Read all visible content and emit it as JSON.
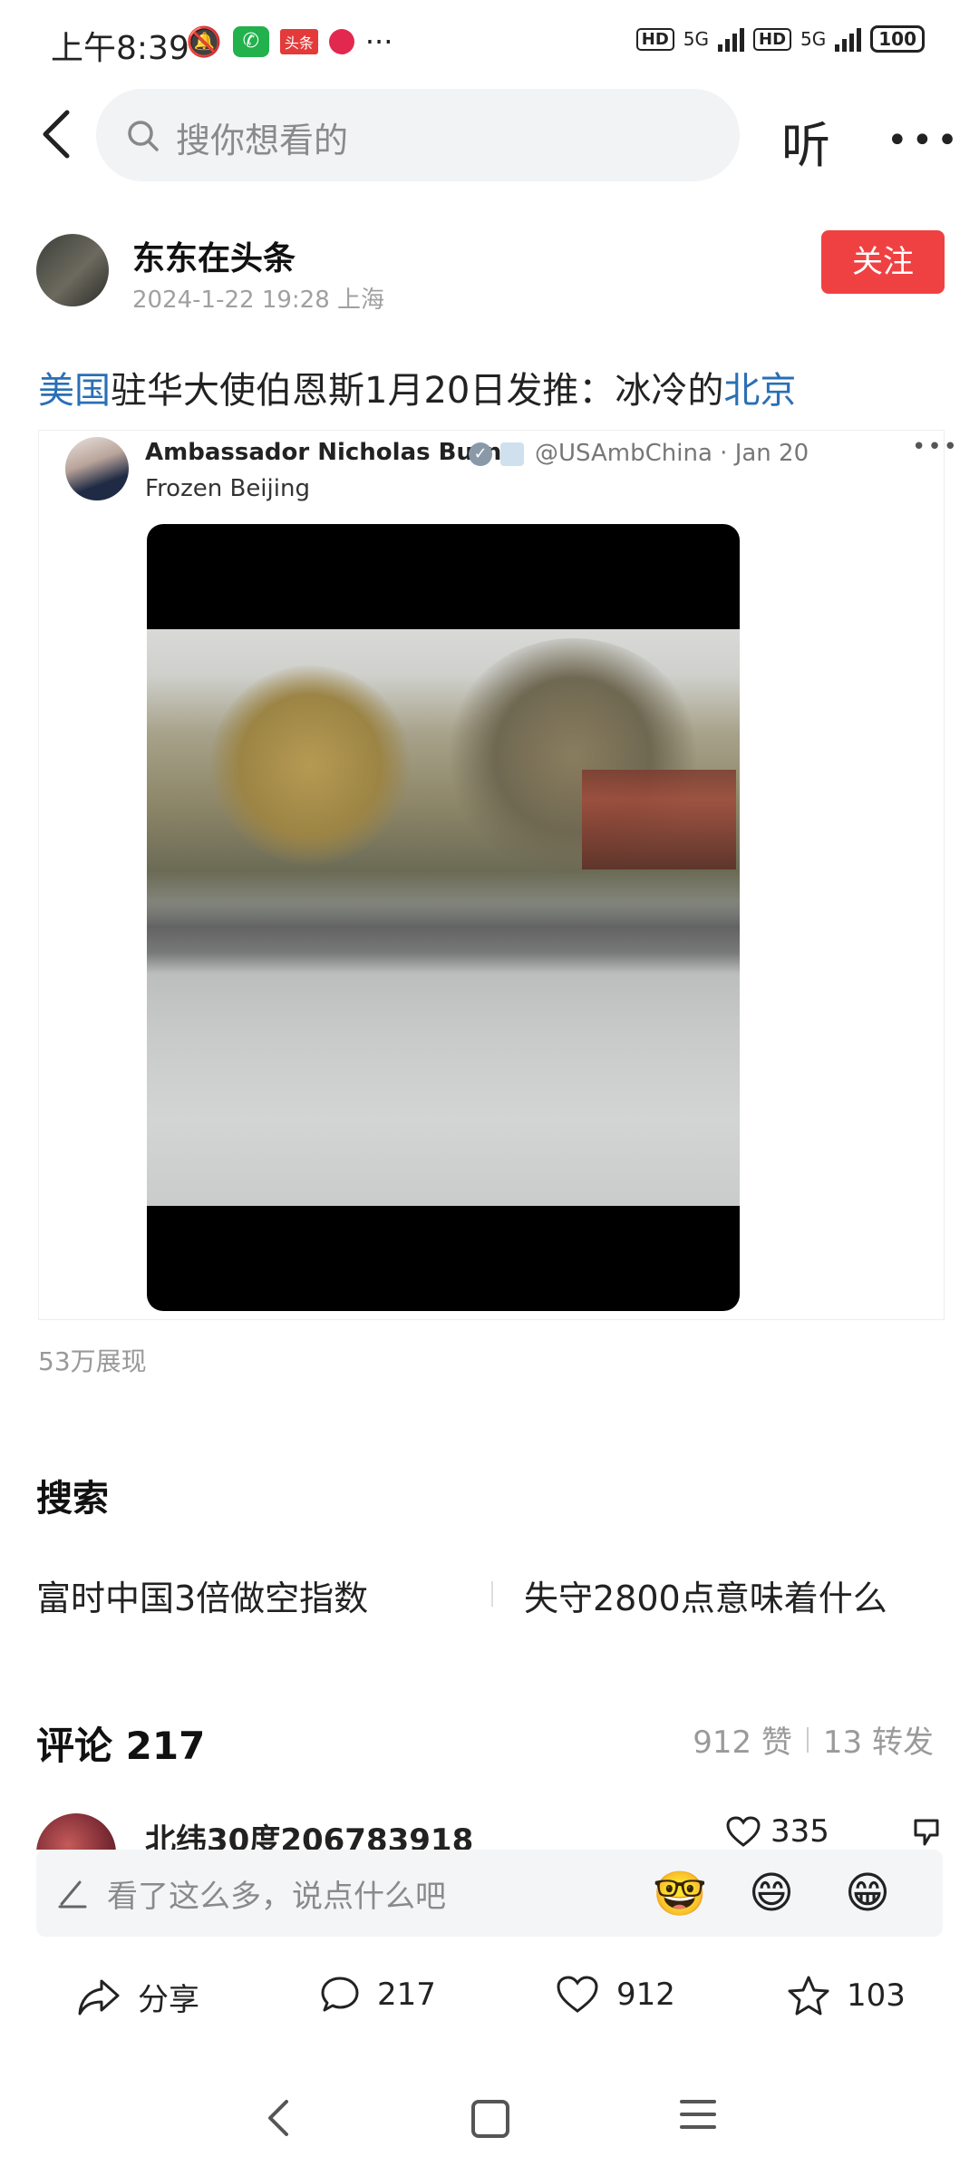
{
  "status_bar": {
    "time": "上午8:39",
    "toutiao_badge": "头条",
    "network_1": "5G",
    "network_2": "5G",
    "hd_1": "HD",
    "hd_2": "HD",
    "battery": "100"
  },
  "header": {
    "search_placeholder": "搜你想看的",
    "listen_label": "听"
  },
  "author": {
    "name": "东东在头条",
    "meta": "2024-1-22 19:28 上海",
    "follow_label": "关注"
  },
  "post": {
    "title_kw1": "美国",
    "title_mid": "驻华大使伯恩斯1月20日发推：冰冷的",
    "title_kw2": "北京",
    "views": "53万展现"
  },
  "tweet": {
    "author": "Ambassador Nicholas Burns",
    "handle": "@USAmbChina · Jan 20",
    "text": "Frozen Beijing"
  },
  "search_section": {
    "heading": "搜索",
    "suggestions": [
      "富时中国3倍做空指数",
      "失守2800点意味着什么"
    ]
  },
  "comments": {
    "title": "评论 217",
    "likes_stat": "912 赞",
    "shares_stat": "13 转发",
    "first": {
      "name": "北纬30度206783918",
      "likes": "335"
    },
    "input_placeholder": "看了这么多，说点什么吧",
    "emojis": [
      "🤓",
      "😄",
      "😁"
    ]
  },
  "actions": {
    "share": "分享",
    "comment_count": "217",
    "like_count": "912",
    "fav_count": "103"
  },
  "colors": {
    "follow_red": "#f04142",
    "keyword_blue": "#2a6fb5"
  }
}
